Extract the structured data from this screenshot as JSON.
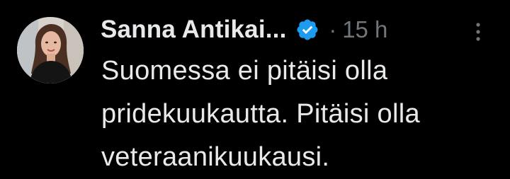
{
  "post": {
    "author_name": "Sanna Antikai...",
    "verified_icon": "verified-badge-icon",
    "separator": "·",
    "timestamp": "15 h",
    "more_icon": "more-vertical-icon",
    "text_lines": [
      "Suomessa ei pitäisi olla",
      "pridekuukautta. Pitäisi olla",
      "veteraanikuukausi."
    ]
  },
  "colors": {
    "background": "#000000",
    "primary_text": "#e7e9ea",
    "secondary_text": "#71767b",
    "verified_blue": "#1d9bf0"
  }
}
